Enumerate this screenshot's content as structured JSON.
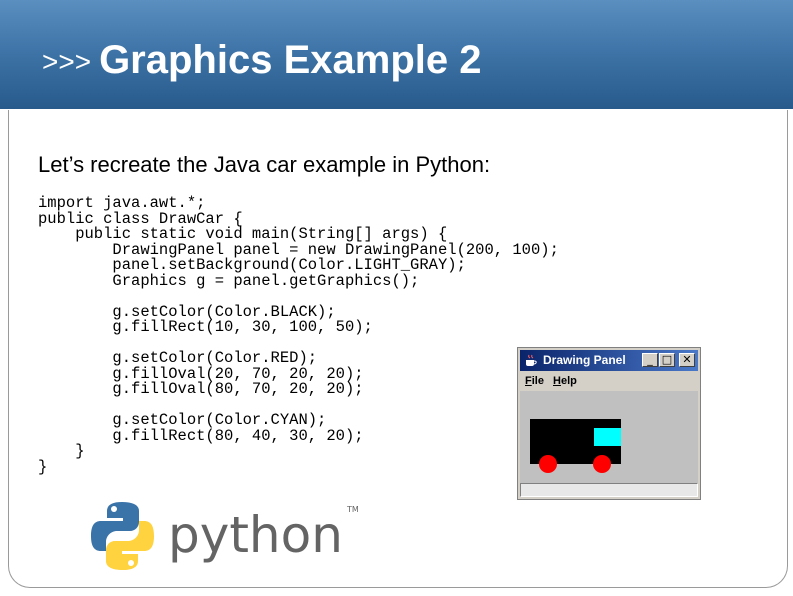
{
  "header": {
    "prompt": ">>>",
    "title": "Graphics Example 2"
  },
  "intro": "Let’s recreate the Java car example in Python:",
  "code_lines": [
    "import java.awt.*;",
    "public class DrawCar {",
    "    public static void main(String[] args) {",
    "        DrawingPanel panel = new DrawingPanel(200, 100);",
    "        panel.setBackground(Color.LIGHT_GRAY);",
    "        Graphics g = panel.getGraphics();",
    "",
    "        g.setColor(Color.BLACK);",
    "        g.fillRect(10, 30, 100, 50);",
    "",
    "        g.setColor(Color.RED);",
    "        g.fillOval(20, 70, 20, 20);",
    "        g.fillOval(80, 70, 20, 20);",
    "",
    "        g.setColor(Color.CYAN);",
    "        g.fillRect(80, 40, 30, 20);",
    "    }",
    "}"
  ],
  "java_window": {
    "title": "Drawing Panel",
    "menu": {
      "file_accel": "F",
      "file_rest": "ile",
      "help_accel": "H",
      "help_rest": "elp"
    },
    "buttons": {
      "minimize": "_",
      "maximize": "□",
      "close": "✕"
    },
    "panel_colors": {
      "background": "#c0c0c0",
      "body": "#000000",
      "wheel": "#ff0000",
      "window": "#00ffff"
    }
  },
  "logo": {
    "wordmark": "python",
    "trademark": "TM",
    "colors": {
      "blue": "#3a73a8",
      "yellow": "#ffd23f",
      "text": "#646464"
    }
  },
  "colors": {
    "header_top": "#5a8fc0",
    "header_bottom": "#285a8c"
  }
}
